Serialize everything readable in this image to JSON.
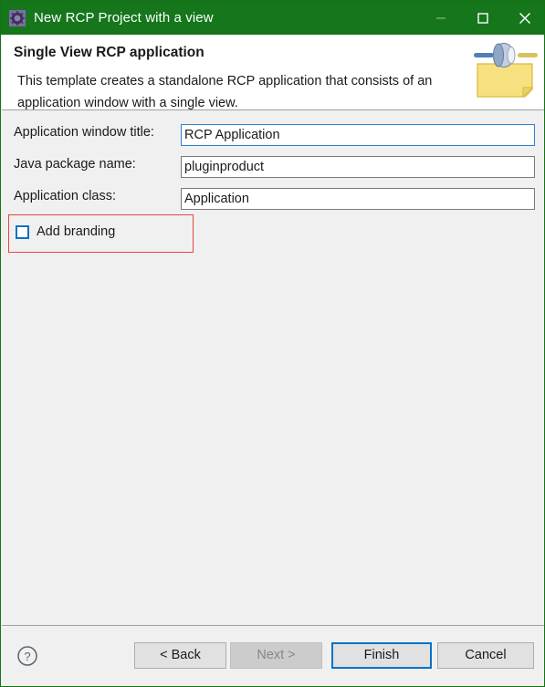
{
  "window": {
    "title": "New RCP Project with a view",
    "titlebar_color": "#15761b",
    "icon": "gear-icon",
    "controls": {
      "minimize": "minimize-icon",
      "maximize": "maximize-icon",
      "close": "close-icon"
    }
  },
  "header": {
    "title": "Single View RCP application",
    "description": "This template creates a standalone RCP application that consists of an application window with a single view.",
    "image": "plugin-folder-icon"
  },
  "form": {
    "fields": [
      {
        "label": "Application window title:",
        "value": "RCP Application",
        "placeholder": "",
        "focused": true
      },
      {
        "label": "Java package name:",
        "value": "pluginproduct",
        "placeholder": "",
        "focused": false
      },
      {
        "label": "Application class:",
        "value": "Application",
        "placeholder": "",
        "focused": false
      }
    ],
    "checkbox": {
      "label": "Add branding",
      "checked": false,
      "highlight_color": "#e8453c"
    }
  },
  "footer": {
    "help_icon": "help-icon",
    "buttons": [
      {
        "label": "< Back",
        "enabled": true,
        "focused": false
      },
      {
        "label": "Next >",
        "enabled": false,
        "focused": false
      },
      {
        "label": "Finish",
        "enabled": true,
        "focused": true
      },
      {
        "label": "Cancel",
        "enabled": true,
        "focused": false
      }
    ]
  },
  "colors": {
    "accent": "#0a72c4",
    "titlebar": "#15761b",
    "panel": "#f0f0f0",
    "highlight": "#e8453c"
  }
}
